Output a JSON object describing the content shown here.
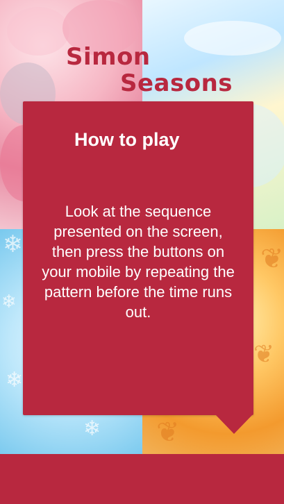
{
  "app": {
    "title_line1": "Simon",
    "title_line2": "Seasons"
  },
  "instructions": {
    "heading": "How to play",
    "body": "Look at the sequence presented on the screen, then press the buttons on your mobile by repeating the pattern before the time runs out."
  },
  "background": {
    "quadrants": [
      "spring",
      "summer",
      "winter",
      "autumn"
    ]
  },
  "colors": {
    "accent": "#b8283f",
    "text_on_accent": "#ffffff"
  },
  "icons": {
    "snowflake": "snowflake-icon",
    "leaf": "leaf-icon",
    "flower": "flower-icon"
  }
}
